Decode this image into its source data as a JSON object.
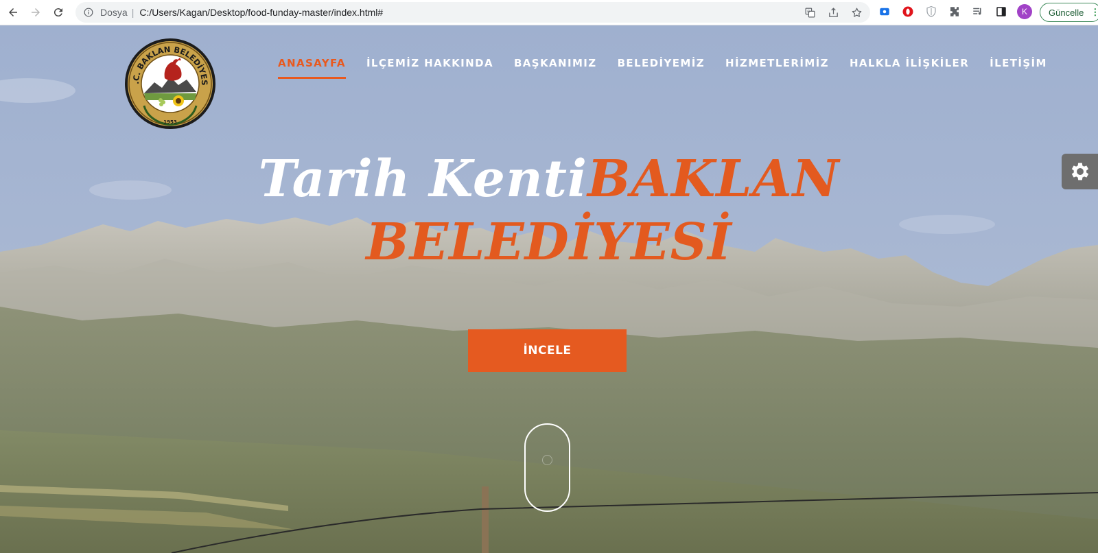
{
  "browser": {
    "scheme_label": "Dosya",
    "separator": "|",
    "url": "C:/Users/Kagan/Desktop/food-funday-master/index.html#",
    "profile_initial": "K",
    "update_label": "Güncelle",
    "icons": [
      "back-icon",
      "forward-icon",
      "reload-icon",
      "info-icon",
      "translate-icon",
      "share-icon",
      "star-icon",
      "screencast-icon",
      "opera-icon",
      "shield-icon",
      "extensions-icon",
      "media-icon",
      "sidepanel-icon"
    ]
  },
  "site": {
    "logo_text": "T.C. BAKLAN BELEDİYESİ",
    "logo_year": "1953",
    "nav": [
      {
        "label": "ANASAYFA",
        "active": true
      },
      {
        "label": "İLÇEMİZ HAKKINDA",
        "active": false
      },
      {
        "label": "BAŞKANIMIZ",
        "active": false
      },
      {
        "label": "BELEDİYEMİZ",
        "active": false
      },
      {
        "label": "HİZMETLERİMİZ",
        "active": false
      },
      {
        "label": "HALKLA İLİŞKİLER",
        "active": false
      },
      {
        "label": "İLETİŞİM",
        "active": false
      }
    ],
    "hero": {
      "title_part1": "Tarih Kenti",
      "title_part2": "BAKLAN",
      "title_line2": "BELEDİYESİ",
      "cta_label": "İNCELE"
    },
    "colors": {
      "accent": "#e8591f",
      "nav_text": "#ffffff",
      "settings_tab": "#6e6e6e"
    }
  }
}
